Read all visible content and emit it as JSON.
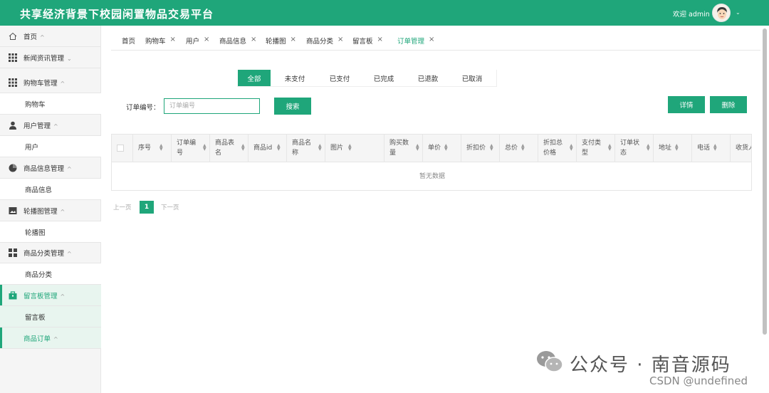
{
  "header": {
    "title": "共享经济背景下校园闲置物品交易平台",
    "welcome": "欢迎 admin",
    "brand_color": "#1fa67a"
  },
  "sidebar": {
    "items": [
      {
        "label": "首页",
        "icon": "home-icon",
        "type": "group",
        "chevron": "^"
      },
      {
        "label": "新闻资讯管理",
        "icon": "grid-icon",
        "type": "group",
        "chevron": "v"
      },
      {
        "label": "购物车管理",
        "icon": "grid-icon",
        "type": "group",
        "chevron": "^"
      },
      {
        "label": "购物车",
        "type": "sub"
      },
      {
        "label": "用户管理",
        "icon": "user-icon",
        "type": "group",
        "chevron": "^"
      },
      {
        "label": "用户",
        "type": "sub"
      },
      {
        "label": "商品信息管理",
        "icon": "pie-icon",
        "type": "group",
        "chevron": "^"
      },
      {
        "label": "商品信息",
        "type": "sub"
      },
      {
        "label": "轮播图管理",
        "icon": "image-icon",
        "type": "group",
        "chevron": "^"
      },
      {
        "label": "轮播图",
        "type": "sub"
      },
      {
        "label": "商品分类管理",
        "icon": "tiles-icon",
        "type": "group",
        "chevron": "^"
      },
      {
        "label": "商品分类",
        "type": "sub"
      },
      {
        "label": "留言板管理",
        "icon": "bag-icon",
        "type": "group",
        "chevron": "^"
      },
      {
        "label": "留言板",
        "type": "sub"
      },
      {
        "label": "商品订单",
        "type": "group",
        "chevron": "^"
      }
    ]
  },
  "tabs": [
    {
      "label": "首页",
      "closable": false
    },
    {
      "label": "购物车",
      "closable": true
    },
    {
      "label": "用户",
      "closable": true
    },
    {
      "label": "商品信息",
      "closable": true
    },
    {
      "label": "轮播图",
      "closable": true
    },
    {
      "label": "商品分类",
      "closable": true
    },
    {
      "label": "留言板",
      "closable": true
    },
    {
      "label": "订单管理",
      "closable": true,
      "active": true
    }
  ],
  "status_filter": {
    "options": [
      "全部",
      "未支付",
      "已支付",
      "已完成",
      "已退款",
      "已取消"
    ],
    "selected": "全部"
  },
  "search": {
    "label": "订单编号：",
    "placeholder": "订单编号",
    "button": "搜索"
  },
  "actions": {
    "detail": "详情",
    "delete": "删除"
  },
  "table": {
    "columns": [
      "序号",
      "订单编号",
      "商品表名",
      "商品id",
      "商品名称",
      "图片",
      "购买数量",
      "单价",
      "折扣价",
      "总价",
      "折扣总价格",
      "支付类型",
      "订单状态",
      "地址",
      "电话",
      "收货人"
    ],
    "empty_text": "暂无数据"
  },
  "pagination": {
    "prev": "上一页",
    "current": "1",
    "next": "下一页"
  },
  "watermark": {
    "text": "公众号 · 南音源码",
    "csdn": "CSDN @undefined"
  }
}
